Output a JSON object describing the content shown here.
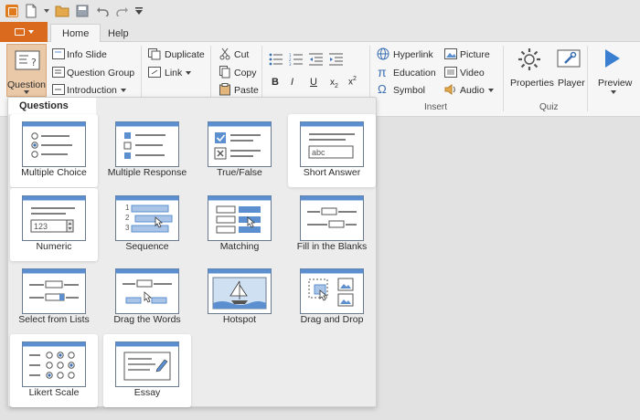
{
  "tabs": {
    "home": "Home",
    "help": "Help"
  },
  "ribbon": {
    "question_label": "Question",
    "slides": {
      "info_slide": "Info Slide",
      "question_group": "Question Group",
      "introduction": "Introduction"
    },
    "edit": {
      "duplicate": "Duplicate",
      "link": "Link"
    },
    "clipboard": {
      "cut": "Cut",
      "copy": "Copy",
      "paste": "Paste"
    },
    "insert": {
      "hyperlink": "Hyperlink",
      "equation": "Education",
      "symbol": "Symbol",
      "picture": "Picture",
      "video": "Video",
      "audio": "Audio"
    },
    "quiz": {
      "properties": "Properties",
      "player": "Player"
    },
    "preview": "Preview",
    "groups": {
      "insert": "Insert",
      "quiz": "Quiz"
    }
  },
  "dropdown": {
    "title": "Questions",
    "items": [
      {
        "label": "Multiple Choice",
        "icon": "multiple-choice-icon"
      },
      {
        "label": "Multiple Response",
        "icon": "multiple-response-icon"
      },
      {
        "label": "True/False",
        "icon": "true-false-icon"
      },
      {
        "label": "Short Answer",
        "icon": "short-answer-icon"
      },
      {
        "label": "Numeric",
        "icon": "numeric-icon"
      },
      {
        "label": "Sequence",
        "icon": "sequence-icon"
      },
      {
        "label": "Matching",
        "icon": "matching-icon"
      },
      {
        "label": "Fill in the Blanks",
        "icon": "fill-in-blanks-icon"
      },
      {
        "label": "Select from Lists",
        "icon": "select-from-lists-icon"
      },
      {
        "label": "Drag the Words",
        "icon": "drag-the-words-icon"
      },
      {
        "label": "Hotspot",
        "icon": "hotspot-icon"
      },
      {
        "label": "Drag and Drop",
        "icon": "drag-and-drop-icon"
      },
      {
        "label": "Likert Scale",
        "icon": "likert-scale-icon"
      },
      {
        "label": "Essay",
        "icon": "essay-icon"
      }
    ],
    "thumb_text": {
      "short_answer": "abc",
      "numeric": "123",
      "seq1": "1",
      "seq2": "2",
      "seq3": "3"
    }
  },
  "colors": {
    "accent": "#d96a1e",
    "blue": "#5b8fd0",
    "highlight": "#ffffff"
  }
}
